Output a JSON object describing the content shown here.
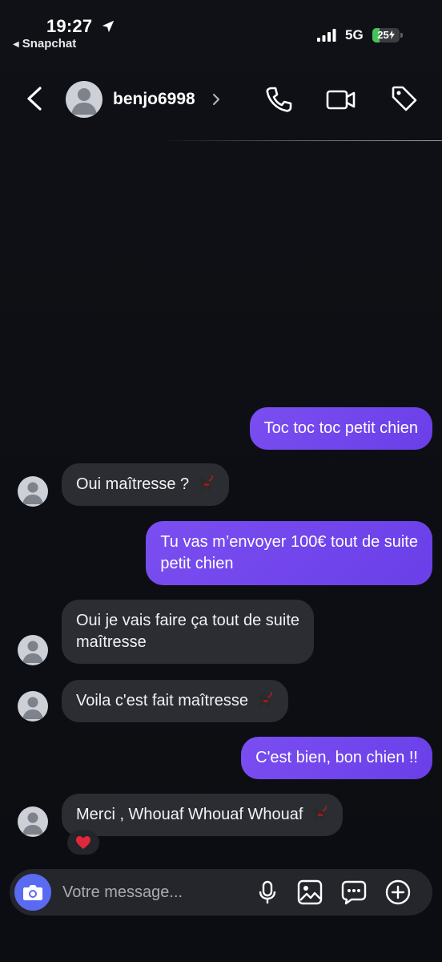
{
  "status_bar": {
    "time": "19:27",
    "back_app": "Snapchat",
    "network": "5G",
    "battery_level": 25,
    "battery_label": "25"
  },
  "header": {
    "contact_name": "benjo6998",
    "icons": [
      "back-chevron-icon",
      "avatar",
      "chevron-right-icon",
      "phone-icon",
      "video-camera-icon",
      "tag-icon"
    ]
  },
  "messages": [
    {
      "side": "out",
      "text": "Toc toc toc petit chien"
    },
    {
      "side": "in",
      "text": "Oui maîtresse ?",
      "emoji": "dog-icon"
    },
    {
      "side": "out",
      "text": "Tu vas m’envoyer 100€ tout de suite\npetit chien"
    },
    {
      "side": "in",
      "text": "Oui je vais faire ça tout de suite\nmaîtresse"
    },
    {
      "side": "in",
      "text": "Voila c'est fait maîtresse",
      "emoji": "dog-icon"
    },
    {
      "side": "out",
      "text": "C'est bien, bon chien !!"
    },
    {
      "side": "in",
      "text": "Merci , Whouaf Whouaf Whouaf",
      "emoji": "dog-icon",
      "reaction": "heart-icon"
    }
  ],
  "input": {
    "placeholder": "Votre message..."
  },
  "colors": {
    "outgoing_bubble": "#6e44ec",
    "incoming_bubble": "#2b2d32",
    "camera_button": "#5a6bf2",
    "battery": "#45c35a"
  }
}
